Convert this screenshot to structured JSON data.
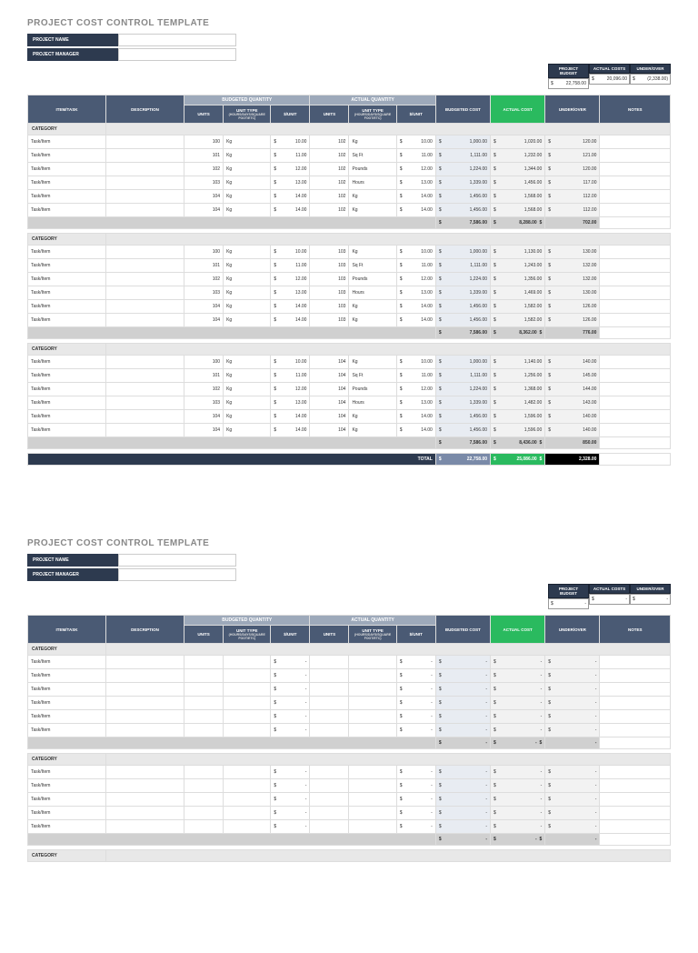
{
  "title": "PROJECT COST CONTROL TEMPLATE",
  "info_labels": {
    "project_name": "PROJECT NAME",
    "project_manager": "PROJECT MANAGER"
  },
  "summary": {
    "headers": {
      "budget": "PROJECT BUDGET",
      "actual": "ACTUAL COSTS",
      "under": "UNDER/OVER"
    },
    "page1": {
      "budget": "22,758.00",
      "actual": "20,096.00",
      "under": "(2,338.00)"
    },
    "page2": {
      "budget": "-",
      "actual": "-",
      "under": "-"
    }
  },
  "group_headers": {
    "budgeted": "BUDGETED QUANTITY",
    "actual": "ACTUAL QUANTITY"
  },
  "col_headers": {
    "item": "ITEM/TASK",
    "desc": "DESCRIPTION",
    "units": "UNITS",
    "unit_type": "UNIT TYPE",
    "unit_type_sub": "(HOURS/DAYS/SQUARE FOOT/ETC)",
    "sunit": "$/UNIT",
    "budgeted_cost": "BUDGETED COST",
    "actual_cost": "ACTUAL COST",
    "under": "UNDER/OVER",
    "notes": "NOTES"
  },
  "labels": {
    "category": "CATEGORY",
    "task": "Task/Item",
    "total": "TOTAL"
  },
  "unit_types": [
    "Kg",
    "Sq Ft",
    "Pounds",
    "Hours"
  ],
  "page1": {
    "sections": [
      {
        "rows": [
          {
            "bu": "100",
            "but": "Kg",
            "bs": "10.00",
            "au": "102",
            "aut": "Kg",
            "as": "10.00",
            "bc": "1,000.00",
            "ac": "1,020.00",
            "uo": "120.00"
          },
          {
            "bu": "101",
            "but": "Kg",
            "bs": "11.00",
            "au": "102",
            "aut": "Sq Ft",
            "as": "11.00",
            "bc": "1,111.00",
            "ac": "1,232.00",
            "uo": "121.00"
          },
          {
            "bu": "102",
            "but": "Kg",
            "bs": "12.00",
            "au": "102",
            "aut": "Pounds",
            "as": "12.00",
            "bc": "1,224.00",
            "ac": "1,344.00",
            "uo": "120.00"
          },
          {
            "bu": "103",
            "but": "Kg",
            "bs": "13.00",
            "au": "102",
            "aut": "Hours",
            "as": "13.00",
            "bc": "1,339.00",
            "ac": "1,456.00",
            "uo": "117.00"
          },
          {
            "bu": "104",
            "but": "Kg",
            "bs": "14.00",
            "au": "102",
            "aut": "Kg",
            "as": "14.00",
            "bc": "1,456.00",
            "ac": "1,568.00",
            "uo": "112.00"
          },
          {
            "bu": "104",
            "but": "Kg",
            "bs": "14.00",
            "au": "102",
            "aut": "Kg",
            "as": "14.00",
            "bc": "1,456.00",
            "ac": "1,568.00",
            "uo": "112.00"
          }
        ],
        "subtotal": {
          "bc": "7,586.00",
          "ac": "8,288.00",
          "uo": "702.00"
        }
      },
      {
        "rows": [
          {
            "bu": "100",
            "but": "Kg",
            "bs": "10.00",
            "au": "103",
            "aut": "Kg",
            "as": "10.00",
            "bc": "1,000.00",
            "ac": "1,130.00",
            "uo": "130.00"
          },
          {
            "bu": "101",
            "but": "Kg",
            "bs": "11.00",
            "au": "103",
            "aut": "Sq Ft",
            "as": "11.00",
            "bc": "1,111.00",
            "ac": "1,243.00",
            "uo": "132.00"
          },
          {
            "bu": "102",
            "but": "Kg",
            "bs": "12.00",
            "au": "103",
            "aut": "Pounds",
            "as": "12.00",
            "bc": "1,224.00",
            "ac": "1,356.00",
            "uo": "132.00"
          },
          {
            "bu": "103",
            "but": "Kg",
            "bs": "13.00",
            "au": "103",
            "aut": "Hours",
            "as": "13.00",
            "bc": "1,339.00",
            "ac": "1,469.00",
            "uo": "130.00"
          },
          {
            "bu": "104",
            "but": "Kg",
            "bs": "14.00",
            "au": "103",
            "aut": "Kg",
            "as": "14.00",
            "bc": "1,456.00",
            "ac": "1,582.00",
            "uo": "126.00"
          },
          {
            "bu": "104",
            "but": "Kg",
            "bs": "14.00",
            "au": "103",
            "aut": "Kg",
            "as": "14.00",
            "bc": "1,456.00",
            "ac": "1,582.00",
            "uo": "126.00"
          }
        ],
        "subtotal": {
          "bc": "7,586.00",
          "ac": "8,362.00",
          "uo": "776.00"
        }
      },
      {
        "rows": [
          {
            "bu": "100",
            "but": "Kg",
            "bs": "10.00",
            "au": "104",
            "aut": "Kg",
            "as": "10.00",
            "bc": "1,000.00",
            "ac": "1,140.00",
            "uo": "140.00"
          },
          {
            "bu": "101",
            "but": "Kg",
            "bs": "11.00",
            "au": "104",
            "aut": "Sq Ft",
            "as": "11.00",
            "bc": "1,111.00",
            "ac": "1,256.00",
            "uo": "145.00"
          },
          {
            "bu": "102",
            "but": "Kg",
            "bs": "12.00",
            "au": "104",
            "aut": "Pounds",
            "as": "12.00",
            "bc": "1,224.00",
            "ac": "1,368.00",
            "uo": "144.00"
          },
          {
            "bu": "103",
            "but": "Kg",
            "bs": "13.00",
            "au": "104",
            "aut": "Hours",
            "as": "13.00",
            "bc": "1,339.00",
            "ac": "1,482.00",
            "uo": "143.00"
          },
          {
            "bu": "104",
            "but": "Kg",
            "bs": "14.00",
            "au": "104",
            "aut": "Kg",
            "as": "14.00",
            "bc": "1,456.00",
            "ac": "1,596.00",
            "uo": "140.00"
          },
          {
            "bu": "104",
            "but": "Kg",
            "bs": "14.00",
            "au": "104",
            "aut": "Kg",
            "as": "14.00",
            "bc": "1,456.00",
            "ac": "1,596.00",
            "uo": "140.00"
          }
        ],
        "subtotal": {
          "bc": "7,586.00",
          "ac": "8,436.00",
          "uo": "850.00"
        }
      }
    ],
    "total": {
      "bc": "22,758.00",
      "ac": "25,086.00",
      "uo": "2,328.00"
    }
  }
}
